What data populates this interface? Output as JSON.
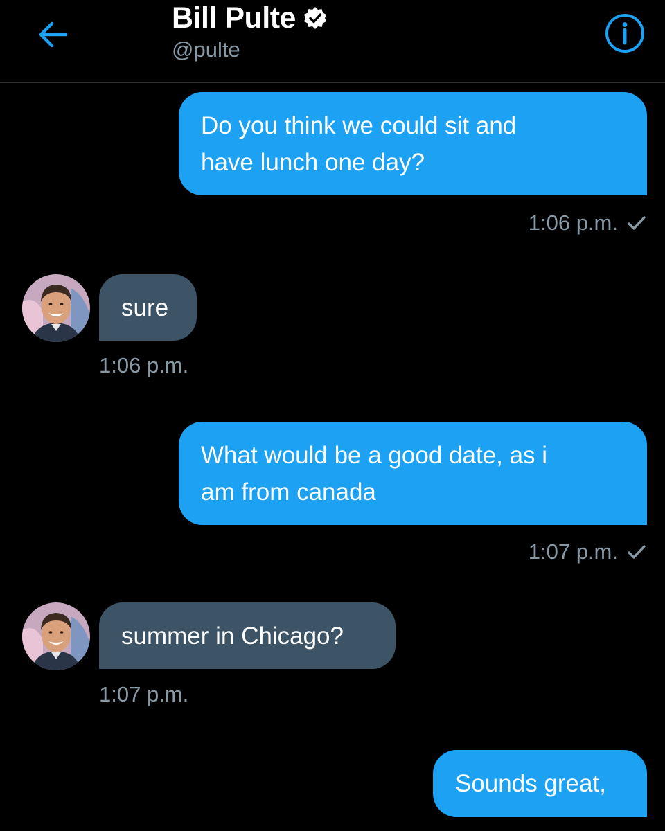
{
  "header": {
    "name": "Bill Pulte",
    "handle": "@pulte",
    "accent_color": "#1da1f2",
    "icons": {
      "back": "arrow-left-icon",
      "verified": "verified-badge-icon",
      "info": "info-circle-icon"
    }
  },
  "messages": [
    {
      "direction": "outgoing",
      "lines": [
        "Do you think we could sit and",
        "have lunch one day?"
      ],
      "time": "1:06 p.m.",
      "status_icon": "check-icon"
    },
    {
      "direction": "incoming",
      "lines": [
        "sure"
      ],
      "time": "1:06 p.m."
    },
    {
      "direction": "outgoing",
      "lines": [
        "What would be a good date, as i",
        "am from canada"
      ],
      "time": "1:07 p.m.",
      "status_icon": "check-icon"
    },
    {
      "direction": "incoming",
      "lines": [
        "summer in Chicago?"
      ],
      "time": "1:07 p.m."
    },
    {
      "direction": "outgoing",
      "lines": [
        "Sounds great,"
      ]
    }
  ],
  "colors": {
    "background": "#000000",
    "outgoing_bubble": "#1da1f2",
    "incoming_bubble": "#3d5466",
    "secondary_text": "#8899a6"
  }
}
